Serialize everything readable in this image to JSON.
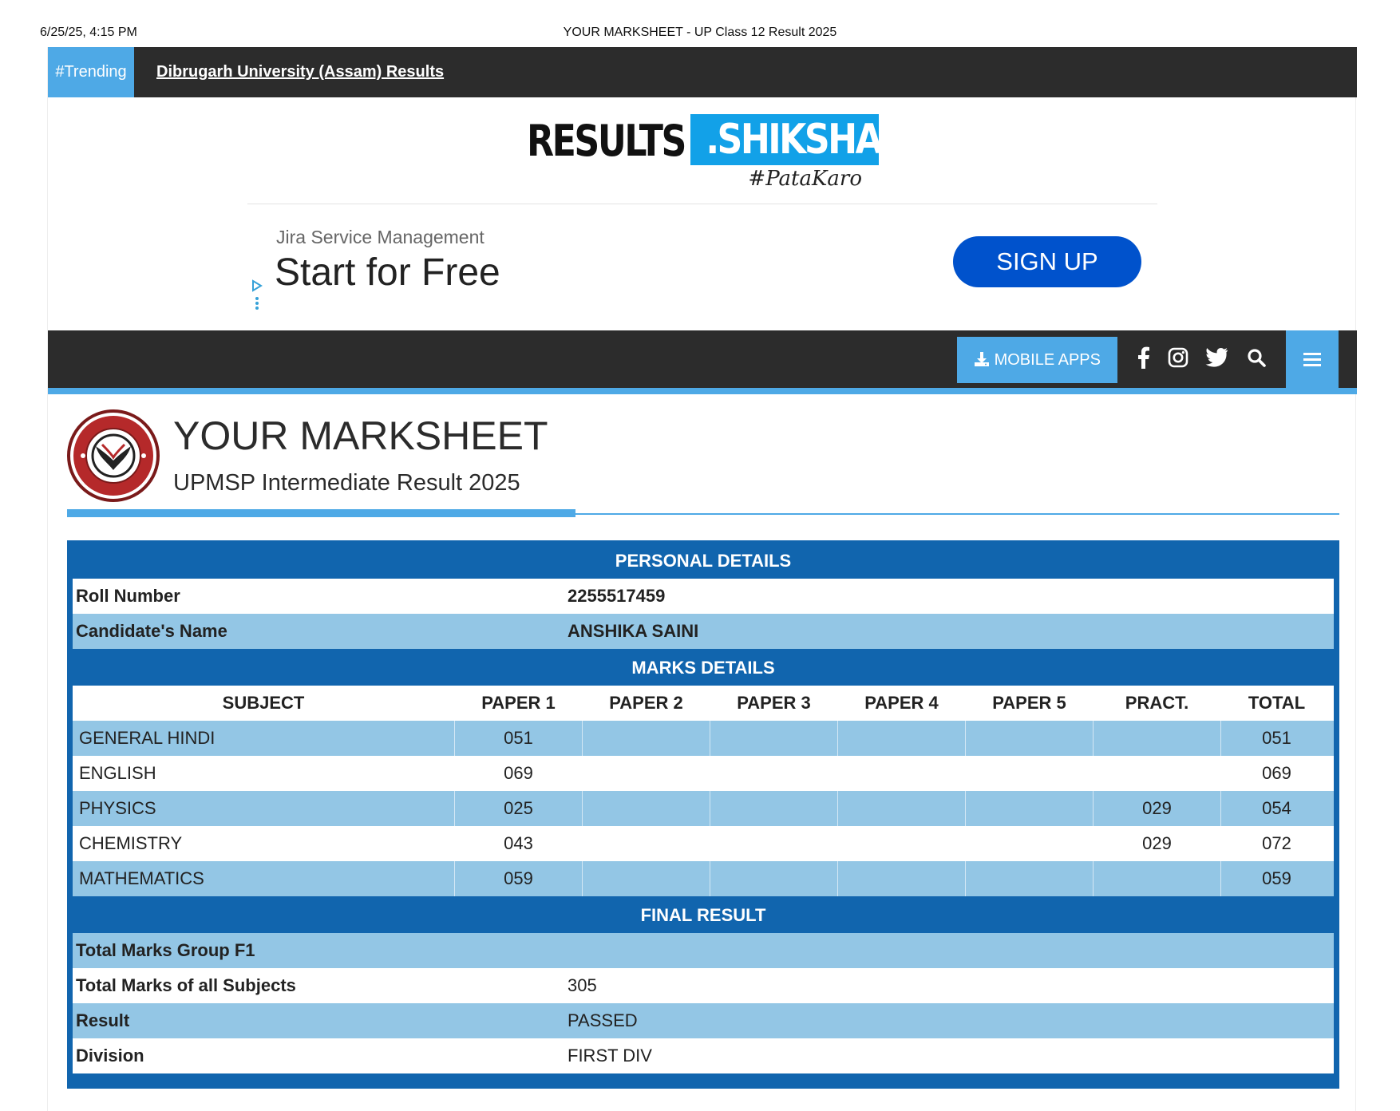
{
  "print_header": {
    "datetime": "6/25/25, 4:15 PM",
    "title": "YOUR MARKSHEET - UP Class 12 Result 2025"
  },
  "trending": {
    "tag": "#Trending",
    "link": "Dibrugarh University (Assam) Results"
  },
  "logo": {
    "part1": "RESULTS",
    "part2": ".SHIKSHA",
    "tagline": "#PataKaro"
  },
  "ad": {
    "brand": "Jira Service Management",
    "headline": "Start for Free",
    "cta": "SIGN UP"
  },
  "navbar": {
    "apps_label": "MOBILE APPS",
    "icons": [
      "facebook-icon",
      "instagram-icon",
      "twitter-icon",
      "search-icon",
      "menu-icon"
    ]
  },
  "marksheet": {
    "title": "YOUR MARKSHEET",
    "subtitle": "UPMSP Intermediate Result 2025"
  },
  "personal": {
    "heading": "PERSONAL DETAILS",
    "rows": [
      {
        "label": "Roll Number",
        "value": "2255517459"
      },
      {
        "label": "Candidate's Name",
        "value": "ANSHIKA SAINI"
      }
    ]
  },
  "marks": {
    "heading": "MARKS DETAILS",
    "columns": [
      "SUBJECT",
      "PAPER 1",
      "PAPER 2",
      "PAPER 3",
      "PAPER 4",
      "PAPER 5",
      "PRACT.",
      "TOTAL"
    ],
    "rows": [
      [
        "GENERAL HINDI",
        "051",
        "",
        "",
        "",
        "",
        "",
        "051"
      ],
      [
        "ENGLISH",
        "069",
        "",
        "",
        "",
        "",
        "",
        "069"
      ],
      [
        "PHYSICS",
        "025",
        "",
        "",
        "",
        "",
        "029",
        "054"
      ],
      [
        "CHEMISTRY",
        "043",
        "",
        "",
        "",
        "",
        "029",
        "072"
      ],
      [
        "MATHEMATICS",
        "059",
        "",
        "",
        "",
        "",
        "",
        "059"
      ]
    ]
  },
  "final": {
    "heading": "FINAL RESULT",
    "rows": [
      {
        "label": "Total Marks Group F1",
        "value": ""
      },
      {
        "label": "Total Marks of all Subjects",
        "value": "305"
      },
      {
        "label": "Result",
        "value": "PASSED"
      },
      {
        "label": "Division",
        "value": "FIRST DIV"
      }
    ]
  },
  "colors": {
    "dark_bar": "#2c2c2c",
    "accent": "#4ea9e6",
    "table_blue": "#1165ae",
    "row_alt": "#93c6e5",
    "ad_button": "#0052cc"
  }
}
